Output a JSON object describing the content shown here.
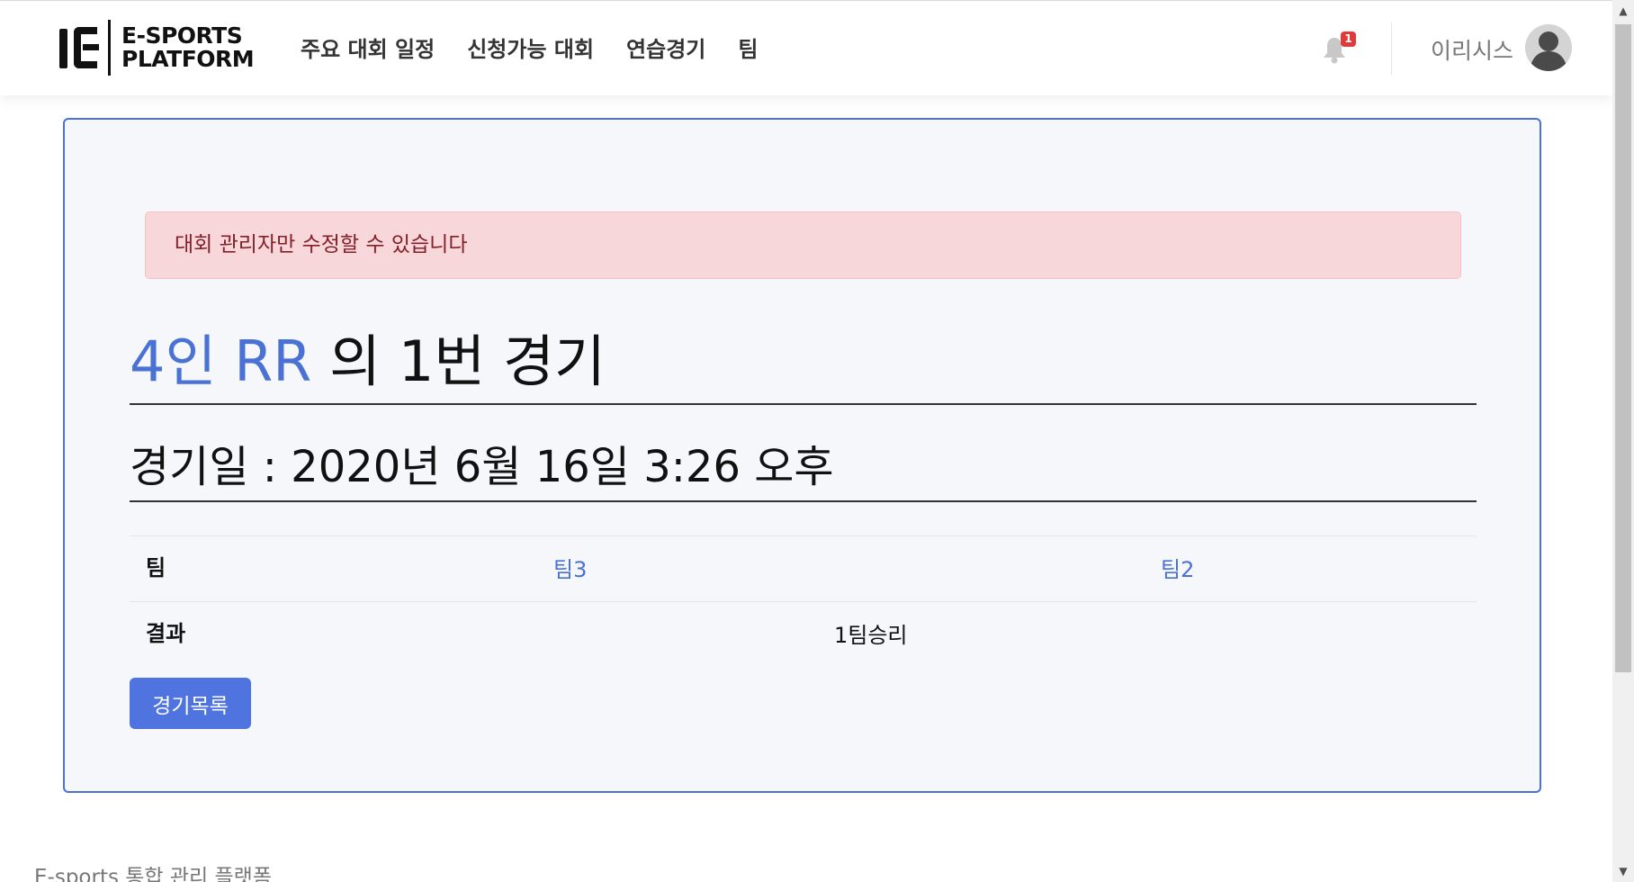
{
  "brand": {
    "line1": "E-SPORTS",
    "line2": "PLATFORM"
  },
  "nav": {
    "items": [
      {
        "label": "주요 대회 일정"
      },
      {
        "label": "신청가능 대회"
      },
      {
        "label": "연습경기"
      },
      {
        "label": "팀"
      }
    ]
  },
  "notifications": {
    "icon": "bell-icon",
    "count": "1"
  },
  "user": {
    "name": "이리시스",
    "avatar_icon": "user-avatar-icon"
  },
  "alert": {
    "message": "대회 관리자만 수정할 수 있습니다"
  },
  "match": {
    "tournament_link": "4인 RR",
    "title_suffix": "의 1번 경기",
    "date_text": "경기일 : 2020년 6월 16일 3:26 오후",
    "team_label": "팀",
    "team_a": "팀3",
    "team_b": "팀2",
    "result_label": "결과",
    "result_value": "1팀승리"
  },
  "actions": {
    "list_button": "경기목록"
  },
  "footer": {
    "text": "E-sports 통합 관리 플랫폼"
  },
  "colors": {
    "accent": "#4a72d4",
    "alert_bg": "#f8d7da",
    "alert_text": "#842029",
    "badge": "#e03b3b"
  }
}
